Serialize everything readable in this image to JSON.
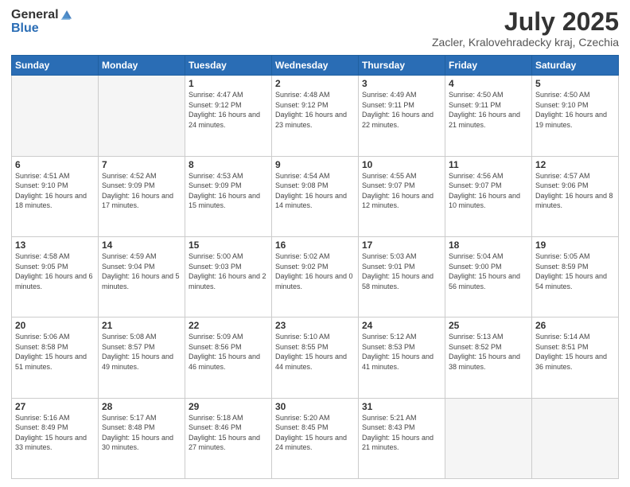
{
  "logo": {
    "general": "General",
    "blue": "Blue"
  },
  "header": {
    "month_year": "July 2025",
    "subtitle": "Zacler, Kralovehradecky kraj, Czechia"
  },
  "days_of_week": [
    "Sunday",
    "Monday",
    "Tuesday",
    "Wednesday",
    "Thursday",
    "Friday",
    "Saturday"
  ],
  "weeks": [
    [
      {
        "day": "",
        "info": ""
      },
      {
        "day": "",
        "info": ""
      },
      {
        "day": "1",
        "sunrise": "4:47 AM",
        "sunset": "9:12 PM",
        "daylight": "16 hours and 24 minutes."
      },
      {
        "day": "2",
        "sunrise": "4:48 AM",
        "sunset": "9:12 PM",
        "daylight": "16 hours and 23 minutes."
      },
      {
        "day": "3",
        "sunrise": "4:49 AM",
        "sunset": "9:11 PM",
        "daylight": "16 hours and 22 minutes."
      },
      {
        "day": "4",
        "sunrise": "4:50 AM",
        "sunset": "9:11 PM",
        "daylight": "16 hours and 21 minutes."
      },
      {
        "day": "5",
        "sunrise": "4:50 AM",
        "sunset": "9:10 PM",
        "daylight": "16 hours and 19 minutes."
      }
    ],
    [
      {
        "day": "6",
        "sunrise": "4:51 AM",
        "sunset": "9:10 PM",
        "daylight": "16 hours and 18 minutes."
      },
      {
        "day": "7",
        "sunrise": "4:52 AM",
        "sunset": "9:09 PM",
        "daylight": "16 hours and 17 minutes."
      },
      {
        "day": "8",
        "sunrise": "4:53 AM",
        "sunset": "9:09 PM",
        "daylight": "16 hours and 15 minutes."
      },
      {
        "day": "9",
        "sunrise": "4:54 AM",
        "sunset": "9:08 PM",
        "daylight": "16 hours and 14 minutes."
      },
      {
        "day": "10",
        "sunrise": "4:55 AM",
        "sunset": "9:07 PM",
        "daylight": "16 hours and 12 minutes."
      },
      {
        "day": "11",
        "sunrise": "4:56 AM",
        "sunset": "9:07 PM",
        "daylight": "16 hours and 10 minutes."
      },
      {
        "day": "12",
        "sunrise": "4:57 AM",
        "sunset": "9:06 PM",
        "daylight": "16 hours and 8 minutes."
      }
    ],
    [
      {
        "day": "13",
        "sunrise": "4:58 AM",
        "sunset": "9:05 PM",
        "daylight": "16 hours and 6 minutes."
      },
      {
        "day": "14",
        "sunrise": "4:59 AM",
        "sunset": "9:04 PM",
        "daylight": "16 hours and 5 minutes."
      },
      {
        "day": "15",
        "sunrise": "5:00 AM",
        "sunset": "9:03 PM",
        "daylight": "16 hours and 2 minutes."
      },
      {
        "day": "16",
        "sunrise": "5:02 AM",
        "sunset": "9:02 PM",
        "daylight": "16 hours and 0 minutes."
      },
      {
        "day": "17",
        "sunrise": "5:03 AM",
        "sunset": "9:01 PM",
        "daylight": "15 hours and 58 minutes."
      },
      {
        "day": "18",
        "sunrise": "5:04 AM",
        "sunset": "9:00 PM",
        "daylight": "15 hours and 56 minutes."
      },
      {
        "day": "19",
        "sunrise": "5:05 AM",
        "sunset": "8:59 PM",
        "daylight": "15 hours and 54 minutes."
      }
    ],
    [
      {
        "day": "20",
        "sunrise": "5:06 AM",
        "sunset": "8:58 PM",
        "daylight": "15 hours and 51 minutes."
      },
      {
        "day": "21",
        "sunrise": "5:08 AM",
        "sunset": "8:57 PM",
        "daylight": "15 hours and 49 minutes."
      },
      {
        "day": "22",
        "sunrise": "5:09 AM",
        "sunset": "8:56 PM",
        "daylight": "15 hours and 46 minutes."
      },
      {
        "day": "23",
        "sunrise": "5:10 AM",
        "sunset": "8:55 PM",
        "daylight": "15 hours and 44 minutes."
      },
      {
        "day": "24",
        "sunrise": "5:12 AM",
        "sunset": "8:53 PM",
        "daylight": "15 hours and 41 minutes."
      },
      {
        "day": "25",
        "sunrise": "5:13 AM",
        "sunset": "8:52 PM",
        "daylight": "15 hours and 38 minutes."
      },
      {
        "day": "26",
        "sunrise": "5:14 AM",
        "sunset": "8:51 PM",
        "daylight": "15 hours and 36 minutes."
      }
    ],
    [
      {
        "day": "27",
        "sunrise": "5:16 AM",
        "sunset": "8:49 PM",
        "daylight": "15 hours and 33 minutes."
      },
      {
        "day": "28",
        "sunrise": "5:17 AM",
        "sunset": "8:48 PM",
        "daylight": "15 hours and 30 minutes."
      },
      {
        "day": "29",
        "sunrise": "5:18 AM",
        "sunset": "8:46 PM",
        "daylight": "15 hours and 27 minutes."
      },
      {
        "day": "30",
        "sunrise": "5:20 AM",
        "sunset": "8:45 PM",
        "daylight": "15 hours and 24 minutes."
      },
      {
        "day": "31",
        "sunrise": "5:21 AM",
        "sunset": "8:43 PM",
        "daylight": "15 hours and 21 minutes."
      },
      {
        "day": "",
        "info": ""
      },
      {
        "day": "",
        "info": ""
      }
    ]
  ]
}
